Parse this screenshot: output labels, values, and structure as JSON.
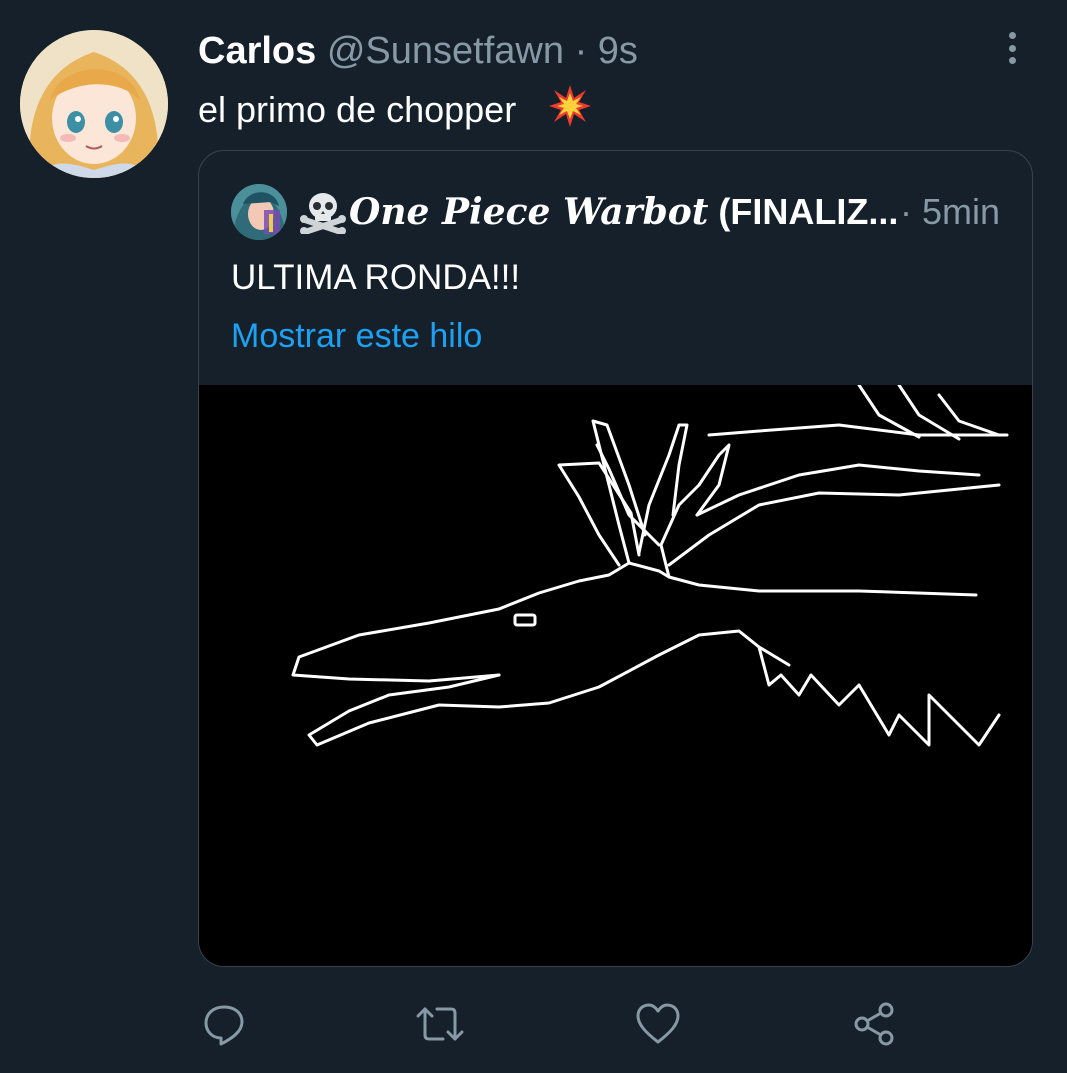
{
  "tweet": {
    "author_name": "Carlos",
    "author_handle": "@Sunsetfawn",
    "separator": "·",
    "time": "9s",
    "text": "el primo de chopper",
    "emoji_icon": "collision-icon",
    "avatar_icon": "anime-girl-avatar"
  },
  "quoted": {
    "author_name_script": "One Piece Warbot",
    "author_name_suffix": "(FINALIZ...",
    "separator": "·",
    "time": "5min",
    "text": "ULTIMA RONDA!!!",
    "show_thread": "Mostrar este hilo",
    "skull_icon": "skull-crossbones-icon",
    "media_description_icon": "line-drawing-bird-image"
  },
  "actions": [
    {
      "icon": "reply-icon"
    },
    {
      "icon": "retweet-icon"
    },
    {
      "icon": "like-icon"
    },
    {
      "icon": "share-icon"
    }
  ],
  "colors": {
    "background": "#15202b",
    "secondary_text": "#8899a6",
    "link": "#1da1f2",
    "border": "#38444d"
  }
}
